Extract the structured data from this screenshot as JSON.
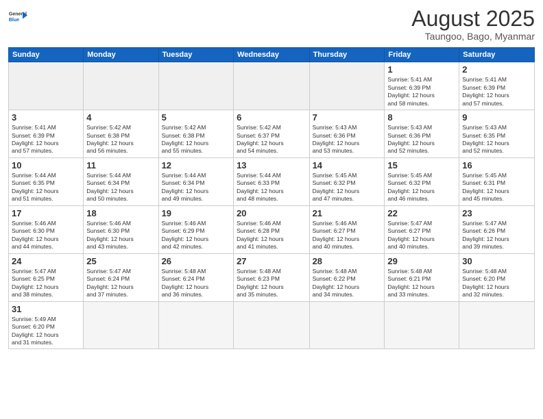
{
  "header": {
    "logo_general": "General",
    "logo_blue": "Blue",
    "month_year": "August 2025",
    "subtitle": "Taungoo, Bago, Myanmar"
  },
  "weekdays": [
    "Sunday",
    "Monday",
    "Tuesday",
    "Wednesday",
    "Thursday",
    "Friday",
    "Saturday"
  ],
  "weeks": [
    [
      {
        "day": "",
        "info": ""
      },
      {
        "day": "",
        "info": ""
      },
      {
        "day": "",
        "info": ""
      },
      {
        "day": "",
        "info": ""
      },
      {
        "day": "",
        "info": ""
      },
      {
        "day": "1",
        "info": "Sunrise: 5:41 AM\nSunset: 6:39 PM\nDaylight: 12 hours\nand 58 minutes."
      },
      {
        "day": "2",
        "info": "Sunrise: 5:41 AM\nSunset: 6:39 PM\nDaylight: 12 hours\nand 57 minutes."
      }
    ],
    [
      {
        "day": "3",
        "info": "Sunrise: 5:41 AM\nSunset: 6:39 PM\nDaylight: 12 hours\nand 57 minutes."
      },
      {
        "day": "4",
        "info": "Sunrise: 5:42 AM\nSunset: 6:38 PM\nDaylight: 12 hours\nand 56 minutes."
      },
      {
        "day": "5",
        "info": "Sunrise: 5:42 AM\nSunset: 6:38 PM\nDaylight: 12 hours\nand 55 minutes."
      },
      {
        "day": "6",
        "info": "Sunrise: 5:42 AM\nSunset: 6:37 PM\nDaylight: 12 hours\nand 54 minutes."
      },
      {
        "day": "7",
        "info": "Sunrise: 5:43 AM\nSunset: 6:36 PM\nDaylight: 12 hours\nand 53 minutes."
      },
      {
        "day": "8",
        "info": "Sunrise: 5:43 AM\nSunset: 6:36 PM\nDaylight: 12 hours\nand 52 minutes."
      },
      {
        "day": "9",
        "info": "Sunrise: 5:43 AM\nSunset: 6:35 PM\nDaylight: 12 hours\nand 52 minutes."
      }
    ],
    [
      {
        "day": "10",
        "info": "Sunrise: 5:44 AM\nSunset: 6:35 PM\nDaylight: 12 hours\nand 51 minutes."
      },
      {
        "day": "11",
        "info": "Sunrise: 5:44 AM\nSunset: 6:34 PM\nDaylight: 12 hours\nand 50 minutes."
      },
      {
        "day": "12",
        "info": "Sunrise: 5:44 AM\nSunset: 6:34 PM\nDaylight: 12 hours\nand 49 minutes."
      },
      {
        "day": "13",
        "info": "Sunrise: 5:44 AM\nSunset: 6:33 PM\nDaylight: 12 hours\nand 48 minutes."
      },
      {
        "day": "14",
        "info": "Sunrise: 5:45 AM\nSunset: 6:32 PM\nDaylight: 12 hours\nand 47 minutes."
      },
      {
        "day": "15",
        "info": "Sunrise: 5:45 AM\nSunset: 6:32 PM\nDaylight: 12 hours\nand 46 minutes."
      },
      {
        "day": "16",
        "info": "Sunrise: 5:45 AM\nSunset: 6:31 PM\nDaylight: 12 hours\nand 45 minutes."
      }
    ],
    [
      {
        "day": "17",
        "info": "Sunrise: 5:46 AM\nSunset: 6:30 PM\nDaylight: 12 hours\nand 44 minutes."
      },
      {
        "day": "18",
        "info": "Sunrise: 5:46 AM\nSunset: 6:30 PM\nDaylight: 12 hours\nand 43 minutes."
      },
      {
        "day": "19",
        "info": "Sunrise: 5:46 AM\nSunset: 6:29 PM\nDaylight: 12 hours\nand 42 minutes."
      },
      {
        "day": "20",
        "info": "Sunrise: 5:46 AM\nSunset: 6:28 PM\nDaylight: 12 hours\nand 41 minutes."
      },
      {
        "day": "21",
        "info": "Sunrise: 5:46 AM\nSunset: 6:27 PM\nDaylight: 12 hours\nand 40 minutes."
      },
      {
        "day": "22",
        "info": "Sunrise: 5:47 AM\nSunset: 6:27 PM\nDaylight: 12 hours\nand 40 minutes."
      },
      {
        "day": "23",
        "info": "Sunrise: 5:47 AM\nSunset: 6:26 PM\nDaylight: 12 hours\nand 39 minutes."
      }
    ],
    [
      {
        "day": "24",
        "info": "Sunrise: 5:47 AM\nSunset: 6:25 PM\nDaylight: 12 hours\nand 38 minutes."
      },
      {
        "day": "25",
        "info": "Sunrise: 5:47 AM\nSunset: 6:24 PM\nDaylight: 12 hours\nand 37 minutes."
      },
      {
        "day": "26",
        "info": "Sunrise: 5:48 AM\nSunset: 6:24 PM\nDaylight: 12 hours\nand 36 minutes."
      },
      {
        "day": "27",
        "info": "Sunrise: 5:48 AM\nSunset: 6:23 PM\nDaylight: 12 hours\nand 35 minutes."
      },
      {
        "day": "28",
        "info": "Sunrise: 5:48 AM\nSunset: 6:22 PM\nDaylight: 12 hours\nand 34 minutes."
      },
      {
        "day": "29",
        "info": "Sunrise: 5:48 AM\nSunset: 6:21 PM\nDaylight: 12 hours\nand 33 minutes."
      },
      {
        "day": "30",
        "info": "Sunrise: 5:48 AM\nSunset: 6:20 PM\nDaylight: 12 hours\nand 32 minutes."
      }
    ],
    [
      {
        "day": "31",
        "info": "Sunrise: 5:49 AM\nSunset: 6:20 PM\nDaylight: 12 hours\nand 31 minutes."
      },
      {
        "day": "",
        "info": ""
      },
      {
        "day": "",
        "info": ""
      },
      {
        "day": "",
        "info": ""
      },
      {
        "day": "",
        "info": ""
      },
      {
        "day": "",
        "info": ""
      },
      {
        "day": "",
        "info": ""
      }
    ]
  ]
}
